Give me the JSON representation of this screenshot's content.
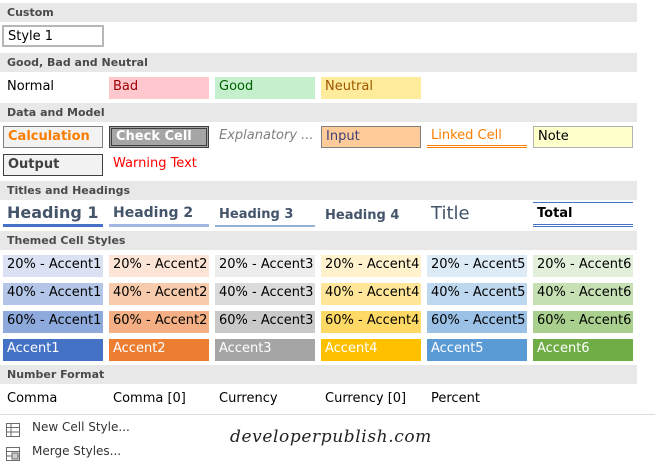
{
  "sections": {
    "custom": "Custom",
    "good_bad_neutral": "Good, Bad and Neutral",
    "data_model": "Data and Model",
    "titles_headings": "Titles and Headings",
    "themed": "Themed Cell Styles",
    "number_format": "Number Format"
  },
  "custom": {
    "style1": "Style 1"
  },
  "gbn": {
    "normal": "Normal",
    "bad": "Bad",
    "good": "Good",
    "neutral": "Neutral"
  },
  "data_model": {
    "calculation": "Calculation",
    "check_cell": "Check Cell",
    "explanatory": "Explanatory ...",
    "input": "Input",
    "linked_cell": "Linked Cell",
    "note": "Note",
    "output": "Output",
    "warning_text": "Warning Text"
  },
  "titles": {
    "heading1": "Heading 1",
    "heading2": "Heading 2",
    "heading3": "Heading 3",
    "heading4": "Heading 4",
    "title": "Title",
    "total": "Total"
  },
  "themed": {
    "r20": [
      "20% - Accent1",
      "20% - Accent2",
      "20% - Accent3",
      "20% - Accent4",
      "20% - Accent5",
      "20% - Accent6"
    ],
    "r40": [
      "40% - Accent1",
      "40% - Accent2",
      "40% - Accent3",
      "40% - Accent4",
      "40% - Accent5",
      "40% - Accent6"
    ],
    "r60": [
      "60% - Accent1",
      "60% - Accent2",
      "60% - Accent3",
      "60% - Accent4",
      "60% - Accent5",
      "60% - Accent6"
    ],
    "accent": [
      "Accent1",
      "Accent2",
      "Accent3",
      "Accent4",
      "Accent5",
      "Accent6"
    ]
  },
  "number_format": {
    "comma": "Comma",
    "comma0": "Comma [0]",
    "currency": "Currency",
    "currency0": "Currency [0]",
    "percent": "Percent"
  },
  "menu": {
    "new_cell_style": "New Cell Style...",
    "merge_styles": "Merge Styles..."
  },
  "watermark": "developerpublish.com",
  "colors": {
    "accent1": "#4472C4",
    "accent2": "#ED7D31",
    "accent3": "#A5A5A5",
    "accent4": "#FFC000",
    "accent5": "#5B9BD5",
    "accent6": "#70AD47",
    "bad_fill": "#FFC7CE",
    "bad_text": "#9C0006",
    "good_fill": "#C6EFCE",
    "good_text": "#006100",
    "neutral_fill": "#FFEB9C",
    "neutral_text": "#9C5700"
  }
}
